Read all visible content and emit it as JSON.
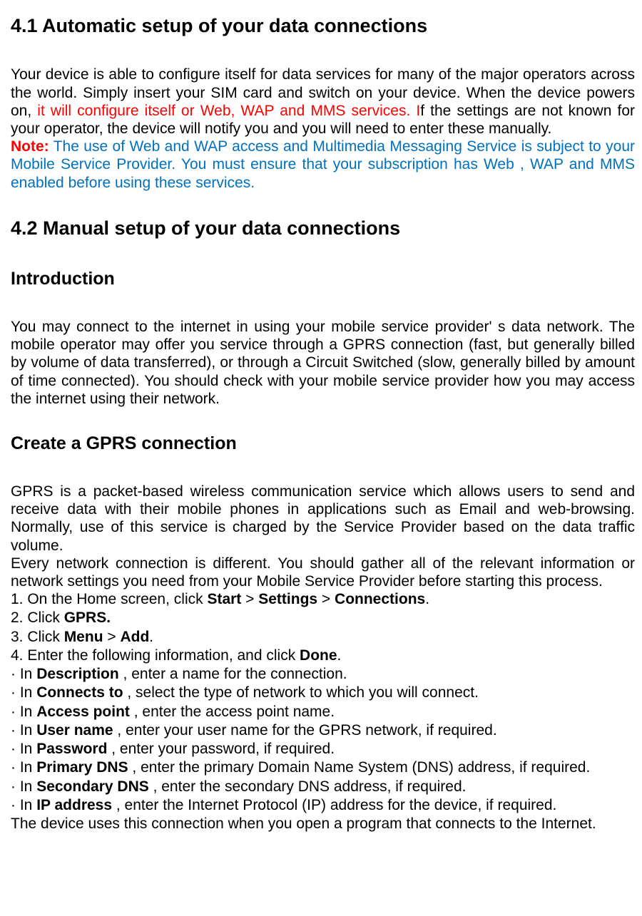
{
  "h41": "4.1 Automatic setup of your data connections",
  "p41_a": "Your device is able to configure itself for data services for many of the major operators across the world. Simply insert your SIM card and switch on your device. When the device powers on, ",
  "p41_red": "it will configure itself or Web, WAP and MMS services. I",
  "p41_b": "f the settings are not known for your operator, the device will notify you and you will need to enter these manually.",
  "note_label": "Note:",
  "note_text": " The use of Web and WAP access and Multimedia Messaging Service is subject to your Mobile Service Provider. You must ensure that your subscription has Web , WAP and MMS enabled before using these services.",
  "h42": "4.2 Manual setup of your data connections",
  "h_intro": "Introduction",
  "p_intro": "You may connect to the internet in using your mobile service provider' s data network. The mobile operator may offer you service through a GPRS connection (fast, but generally billed by volume of data transferred), or through a Circuit Switched (slow, generally billed by amount of time connected). You should check with your mobile service provider how you may access the internet using their network.",
  "h_gprs": "Create a GPRS connection",
  "p_gprs1": "GPRS is a packet-based wireless communication service which allows users to send and receive data with their mobile phones in applications such as Email and web-browsing. Normally, use of this service is charged by the Service Provider based on the data traffic volume.",
  "p_gprs2": "Every network connection is different. You should gather all of the relevant information or network settings you need from your Mobile Service Provider before starting this process.",
  "s1a": "1. On the Home screen, click ",
  "s1b": "Start",
  "s1c": " > ",
  "s1d": "Settings",
  "s1e": " > ",
  "s1f": "Connections",
  "s1g": ".",
  "s2a": "2. Click ",
  "s2b": "GPRS.",
  "s3a": "3. Click ",
  "s3b": "Menu",
  "s3c": " > ",
  "s3d": "Add",
  "s3e": ".",
  "s4a": "4. Enter the following information, and click ",
  "s4b": "Done",
  "s4c": ".",
  "b1a": "·  In ",
  "b1b": "Description",
  "b1c": " , enter a name for the connection.",
  "b2a": "·  In ",
  "b2b": "Connects to",
  "b2c": " , select the type of network to which you will connect.",
  "b3a": "·  In ",
  "b3b": "Access point",
  "b3c": " , enter the access point name.",
  "b4a": "·  In ",
  "b4b": "User name",
  "b4c": " , enter your user name for the GPRS network, if required.",
  "b5a": "·  In ",
  "b5b": "Password",
  "b5c": " , enter your password, if required.",
  "b6a": "·  In ",
  "b6b": "Primary DNS",
  "b6c": " , enter the primary Domain Name System (DNS) address, if required.",
  "b7a": "·  In ",
  "b7b": "Secondary DNS",
  "b7c": " , enter the secondary DNS address, if required.",
  "b8a": "·  In ",
  "b8b": "IP address",
  "b8c": " , enter the Internet Protocol (IP) address for the device, if required.",
  "p_last": "The device uses this connection when you open a program that connects to the Internet."
}
